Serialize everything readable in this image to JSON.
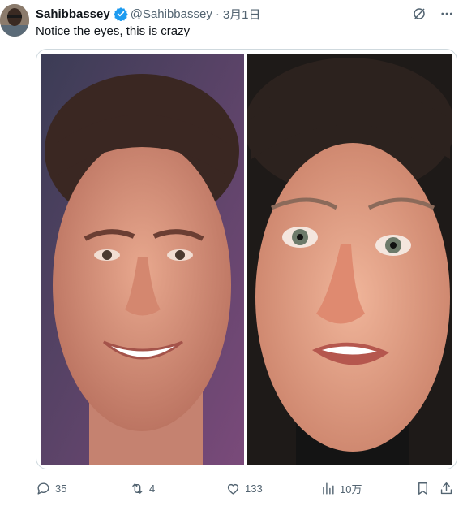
{
  "tweet": {
    "display_name": "Sahibbassey",
    "handle": "@Sahibbassey",
    "separator": "·",
    "date": "3月1日",
    "text": "Notice the eyes, this is crazy"
  },
  "actions": {
    "replies": "35",
    "retweets": "4",
    "likes": "133",
    "views": "10万"
  },
  "colors": {
    "verified": "#1d9bf0",
    "secondary_text": "#536471",
    "border": "#cfd9de"
  },
  "icons": [
    "verified-badge-icon",
    "grok-icon",
    "more-icon",
    "reply-icon",
    "retweet-icon",
    "like-icon",
    "views-icon",
    "bookmark-icon",
    "share-icon"
  ]
}
